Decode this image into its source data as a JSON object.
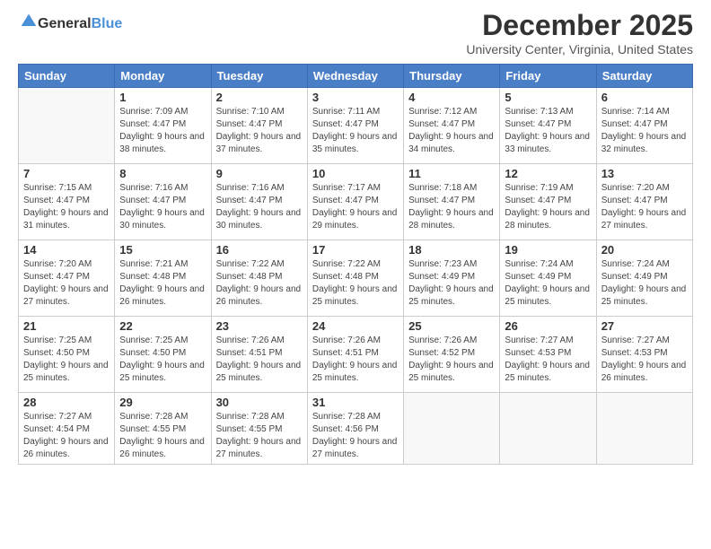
{
  "logo": {
    "general": "General",
    "blue": "Blue"
  },
  "header": {
    "month": "December 2025",
    "location": "University Center, Virginia, United States"
  },
  "weekdays": [
    "Sunday",
    "Monday",
    "Tuesday",
    "Wednesday",
    "Thursday",
    "Friday",
    "Saturday"
  ],
  "weeks": [
    [
      {
        "day": "",
        "sunrise": "",
        "sunset": "",
        "daylight": ""
      },
      {
        "day": "1",
        "sunrise": "Sunrise: 7:09 AM",
        "sunset": "Sunset: 4:47 PM",
        "daylight": "Daylight: 9 hours and 38 minutes."
      },
      {
        "day": "2",
        "sunrise": "Sunrise: 7:10 AM",
        "sunset": "Sunset: 4:47 PM",
        "daylight": "Daylight: 9 hours and 37 minutes."
      },
      {
        "day": "3",
        "sunrise": "Sunrise: 7:11 AM",
        "sunset": "Sunset: 4:47 PM",
        "daylight": "Daylight: 9 hours and 35 minutes."
      },
      {
        "day": "4",
        "sunrise": "Sunrise: 7:12 AM",
        "sunset": "Sunset: 4:47 PM",
        "daylight": "Daylight: 9 hours and 34 minutes."
      },
      {
        "day": "5",
        "sunrise": "Sunrise: 7:13 AM",
        "sunset": "Sunset: 4:47 PM",
        "daylight": "Daylight: 9 hours and 33 minutes."
      },
      {
        "day": "6",
        "sunrise": "Sunrise: 7:14 AM",
        "sunset": "Sunset: 4:47 PM",
        "daylight": "Daylight: 9 hours and 32 minutes."
      }
    ],
    [
      {
        "day": "7",
        "sunrise": "Sunrise: 7:15 AM",
        "sunset": "Sunset: 4:47 PM",
        "daylight": "Daylight: 9 hours and 31 minutes."
      },
      {
        "day": "8",
        "sunrise": "Sunrise: 7:16 AM",
        "sunset": "Sunset: 4:47 PM",
        "daylight": "Daylight: 9 hours and 30 minutes."
      },
      {
        "day": "9",
        "sunrise": "Sunrise: 7:16 AM",
        "sunset": "Sunset: 4:47 PM",
        "daylight": "Daylight: 9 hours and 30 minutes."
      },
      {
        "day": "10",
        "sunrise": "Sunrise: 7:17 AM",
        "sunset": "Sunset: 4:47 PM",
        "daylight": "Daylight: 9 hours and 29 minutes."
      },
      {
        "day": "11",
        "sunrise": "Sunrise: 7:18 AM",
        "sunset": "Sunset: 4:47 PM",
        "daylight": "Daylight: 9 hours and 28 minutes."
      },
      {
        "day": "12",
        "sunrise": "Sunrise: 7:19 AM",
        "sunset": "Sunset: 4:47 PM",
        "daylight": "Daylight: 9 hours and 28 minutes."
      },
      {
        "day": "13",
        "sunrise": "Sunrise: 7:20 AM",
        "sunset": "Sunset: 4:47 PM",
        "daylight": "Daylight: 9 hours and 27 minutes."
      }
    ],
    [
      {
        "day": "14",
        "sunrise": "Sunrise: 7:20 AM",
        "sunset": "Sunset: 4:47 PM",
        "daylight": "Daylight: 9 hours and 27 minutes."
      },
      {
        "day": "15",
        "sunrise": "Sunrise: 7:21 AM",
        "sunset": "Sunset: 4:48 PM",
        "daylight": "Daylight: 9 hours and 26 minutes."
      },
      {
        "day": "16",
        "sunrise": "Sunrise: 7:22 AM",
        "sunset": "Sunset: 4:48 PM",
        "daylight": "Daylight: 9 hours and 26 minutes."
      },
      {
        "day": "17",
        "sunrise": "Sunrise: 7:22 AM",
        "sunset": "Sunset: 4:48 PM",
        "daylight": "Daylight: 9 hours and 25 minutes."
      },
      {
        "day": "18",
        "sunrise": "Sunrise: 7:23 AM",
        "sunset": "Sunset: 4:49 PM",
        "daylight": "Daylight: 9 hours and 25 minutes."
      },
      {
        "day": "19",
        "sunrise": "Sunrise: 7:24 AM",
        "sunset": "Sunset: 4:49 PM",
        "daylight": "Daylight: 9 hours and 25 minutes."
      },
      {
        "day": "20",
        "sunrise": "Sunrise: 7:24 AM",
        "sunset": "Sunset: 4:49 PM",
        "daylight": "Daylight: 9 hours and 25 minutes."
      }
    ],
    [
      {
        "day": "21",
        "sunrise": "Sunrise: 7:25 AM",
        "sunset": "Sunset: 4:50 PM",
        "daylight": "Daylight: 9 hours and 25 minutes."
      },
      {
        "day": "22",
        "sunrise": "Sunrise: 7:25 AM",
        "sunset": "Sunset: 4:50 PM",
        "daylight": "Daylight: 9 hours and 25 minutes."
      },
      {
        "day": "23",
        "sunrise": "Sunrise: 7:26 AM",
        "sunset": "Sunset: 4:51 PM",
        "daylight": "Daylight: 9 hours and 25 minutes."
      },
      {
        "day": "24",
        "sunrise": "Sunrise: 7:26 AM",
        "sunset": "Sunset: 4:51 PM",
        "daylight": "Daylight: 9 hours and 25 minutes."
      },
      {
        "day": "25",
        "sunrise": "Sunrise: 7:26 AM",
        "sunset": "Sunset: 4:52 PM",
        "daylight": "Daylight: 9 hours and 25 minutes."
      },
      {
        "day": "26",
        "sunrise": "Sunrise: 7:27 AM",
        "sunset": "Sunset: 4:53 PM",
        "daylight": "Daylight: 9 hours and 25 minutes."
      },
      {
        "day": "27",
        "sunrise": "Sunrise: 7:27 AM",
        "sunset": "Sunset: 4:53 PM",
        "daylight": "Daylight: 9 hours and 26 minutes."
      }
    ],
    [
      {
        "day": "28",
        "sunrise": "Sunrise: 7:27 AM",
        "sunset": "Sunset: 4:54 PM",
        "daylight": "Daylight: 9 hours and 26 minutes."
      },
      {
        "day": "29",
        "sunrise": "Sunrise: 7:28 AM",
        "sunset": "Sunset: 4:55 PM",
        "daylight": "Daylight: 9 hours and 26 minutes."
      },
      {
        "day": "30",
        "sunrise": "Sunrise: 7:28 AM",
        "sunset": "Sunset: 4:55 PM",
        "daylight": "Daylight: 9 hours and 27 minutes."
      },
      {
        "day": "31",
        "sunrise": "Sunrise: 7:28 AM",
        "sunset": "Sunset: 4:56 PM",
        "daylight": "Daylight: 9 hours and 27 minutes."
      },
      {
        "day": "",
        "sunrise": "",
        "sunset": "",
        "daylight": ""
      },
      {
        "day": "",
        "sunrise": "",
        "sunset": "",
        "daylight": ""
      },
      {
        "day": "",
        "sunrise": "",
        "sunset": "",
        "daylight": ""
      }
    ]
  ]
}
